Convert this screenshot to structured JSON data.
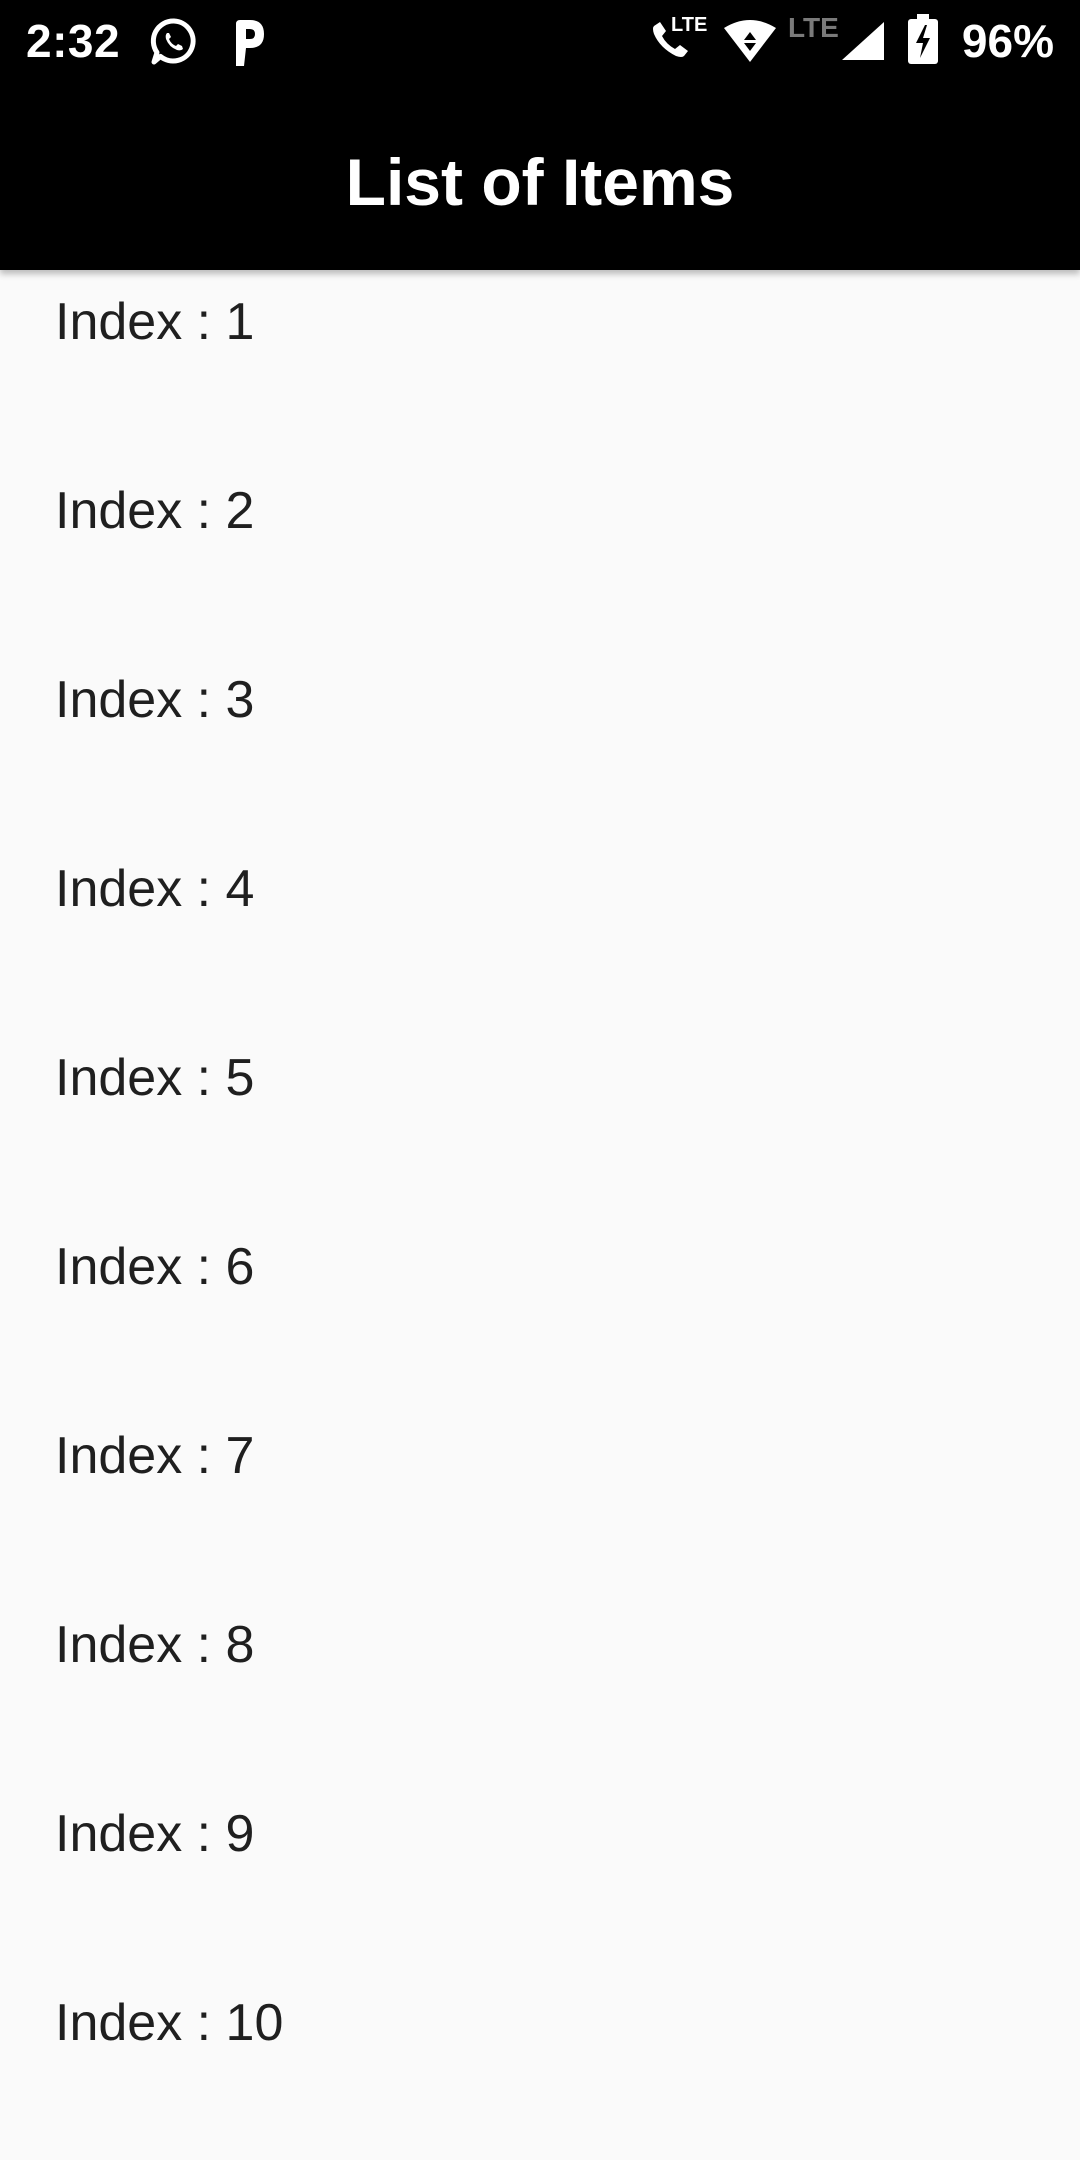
{
  "status_bar": {
    "time": "2:32",
    "lte_label": "LTE",
    "lte_label_secondary": "LTE",
    "battery": "96%",
    "icons": [
      "whatsapp-icon",
      "parking-p-icon",
      "volte-call-icon",
      "wifi-icon",
      "signal-icon",
      "battery-charging-icon"
    ]
  },
  "app_bar": {
    "title": "List of Items"
  },
  "list": {
    "items": [
      {
        "label": "Index : 1"
      },
      {
        "label": "Index : 2"
      },
      {
        "label": "Index : 3"
      },
      {
        "label": "Index : 4"
      },
      {
        "label": "Index : 5"
      },
      {
        "label": "Index : 6"
      },
      {
        "label": "Index : 7"
      },
      {
        "label": "Index : 8"
      },
      {
        "label": "Index : 9"
      },
      {
        "label": "Index : 10"
      }
    ]
  },
  "colors": {
    "app_bar": "#000000",
    "background": "#fafafa",
    "text": "#1f1f1f"
  }
}
